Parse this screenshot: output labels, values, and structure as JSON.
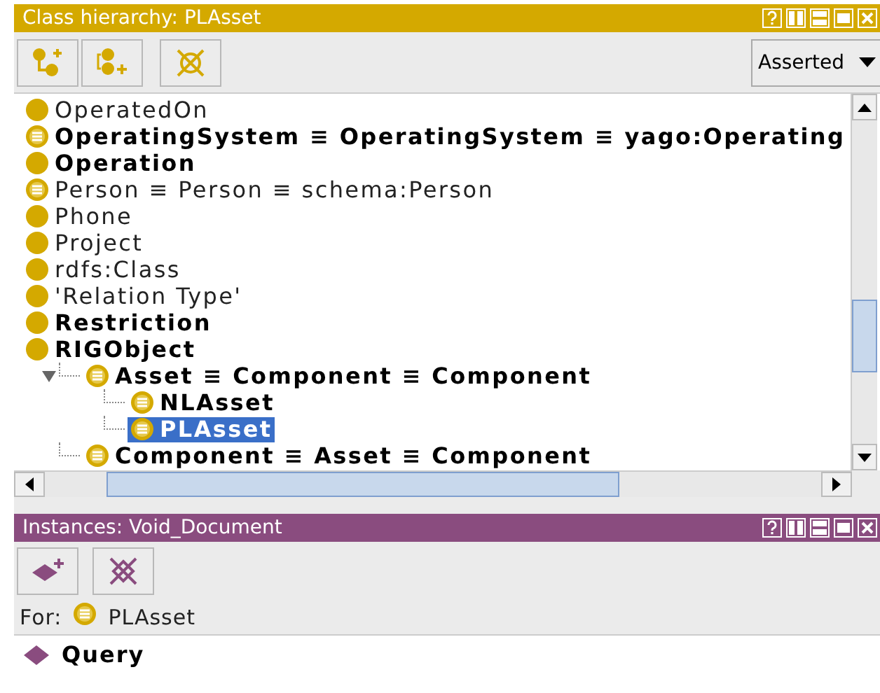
{
  "class_panel": {
    "title": "Class hierarchy: PLAsset",
    "view_mode": "Asserted",
    "classes": [
      {
        "label": "OperatedOn",
        "defined": false,
        "bold": false,
        "selected": false
      },
      {
        "label": "OperatingSystem ≡ OperatingSystem ≡ yago:Operating",
        "defined": true,
        "bold": true,
        "selected": false
      },
      {
        "label": "Operation",
        "defined": false,
        "bold": true,
        "selected": false
      },
      {
        "label": "Person ≡ Person ≡ schema:Person",
        "defined": true,
        "bold": false,
        "selected": false
      },
      {
        "label": "Phone",
        "defined": false,
        "bold": false,
        "selected": false
      },
      {
        "label": "Project",
        "defined": false,
        "bold": false,
        "selected": false
      },
      {
        "label": "rdfs:Class",
        "defined": false,
        "bold": false,
        "selected": false
      },
      {
        "label": "'Relation Type'",
        "defined": false,
        "bold": false,
        "selected": false
      },
      {
        "label": "Restriction",
        "defined": false,
        "bold": true,
        "selected": false
      },
      {
        "label": "RIGObject",
        "defined": false,
        "bold": true,
        "selected": false,
        "children": [
          {
            "label": "Asset ≡ Component ≡ Component",
            "defined": true,
            "bold": true,
            "selected": false,
            "expanded": true,
            "children": [
              {
                "label": "NLAsset",
                "defined": true,
                "bold": true,
                "selected": false
              },
              {
                "label": "PLAsset",
                "defined": true,
                "bold": true,
                "selected": true
              }
            ]
          },
          {
            "label": "Component ≡ Asset ≡ Component",
            "defined": true,
            "bold": true,
            "selected": false
          }
        ]
      }
    ]
  },
  "instances_panel": {
    "title": "Instances: Void_Document",
    "for_label": "For:",
    "for_class": {
      "label": "PLAsset",
      "defined": true
    },
    "instances": [
      {
        "label": "Query",
        "bold": true
      }
    ]
  }
}
